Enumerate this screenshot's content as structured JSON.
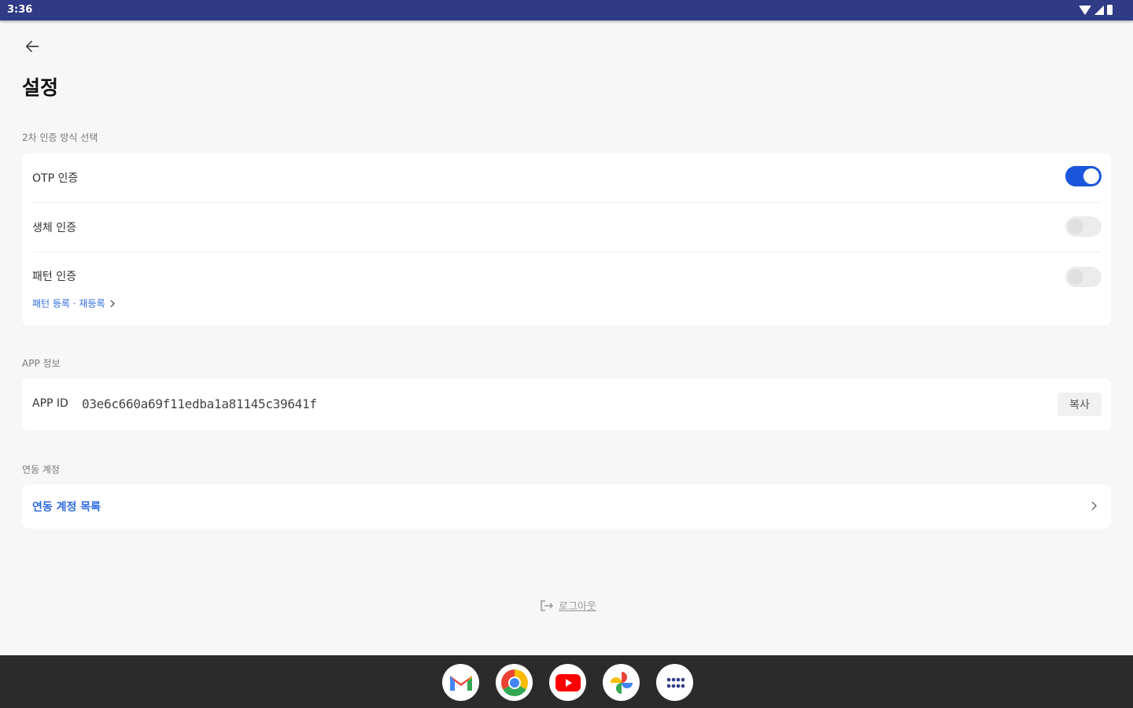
{
  "status_bar": {
    "time": "3:36",
    "icons": [
      "wifi-icon",
      "cellular-icon",
      "battery-icon"
    ]
  },
  "header": {
    "back_icon": "arrow-left-icon",
    "title": "설정"
  },
  "auth_section": {
    "label": "2차 인증 방식 선택",
    "items": [
      {
        "label": "OTP 인증",
        "enabled": true
      },
      {
        "label": "생체 인증",
        "enabled": false
      },
      {
        "label": "패턴 인증",
        "enabled": false,
        "sub_link": "패턴 등록 · 재등록"
      }
    ]
  },
  "app_section": {
    "label": "APP 정보",
    "id_label": "APP ID",
    "id_value": "03e6c660a69f11edba1a81145c39641f",
    "copy_label": "복사"
  },
  "linked_section": {
    "label": "연동 계정",
    "list_label": "연동 계정 목록"
  },
  "logout": {
    "icon": "logout-icon",
    "label": "로그아웃"
  },
  "dock": {
    "apps": [
      "gmail-icon",
      "chrome-icon",
      "youtube-icon",
      "photos-icon",
      "app-drawer-icon"
    ]
  },
  "colors": {
    "status_bar": "#2f3b86",
    "accent": "#1a56db",
    "link": "#2d6be0",
    "nav_bar": "#2b2b2b"
  }
}
